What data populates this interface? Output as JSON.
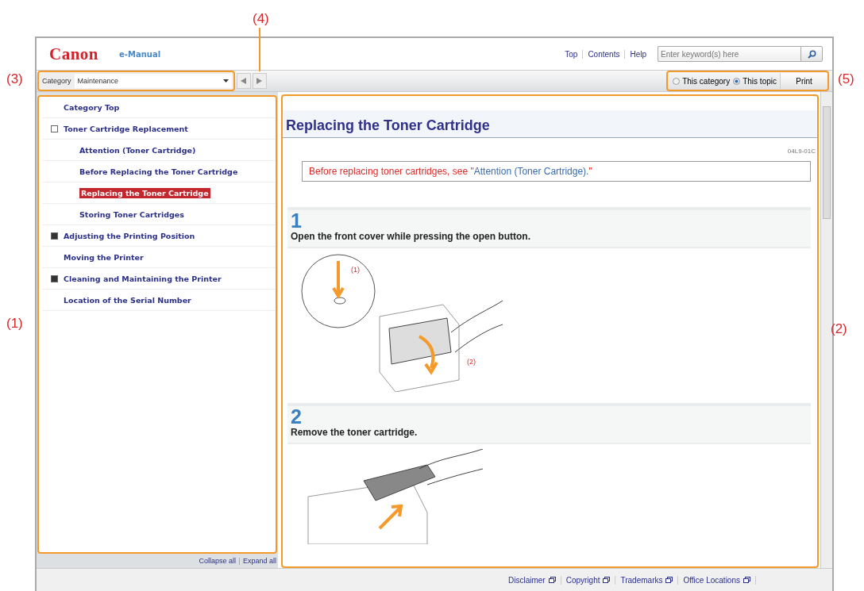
{
  "callouts": [
    {
      "label": "(4)"
    },
    {
      "label": "(3)"
    },
    {
      "label": "(1)"
    },
    {
      "label": "(5)"
    },
    {
      "label": "(2)"
    }
  ],
  "header": {
    "logo": "Canon",
    "product": "e-Manual",
    "links": [
      "Top",
      "Contents",
      "Help"
    ],
    "search": {
      "placeholder": "Enter keyword(s) here"
    }
  },
  "toolbar": {
    "category_label": "Category",
    "category_value": "Maintenance",
    "scope": [
      {
        "label": "This category",
        "selected": false
      },
      {
        "label": "This topic",
        "selected": true
      }
    ],
    "print": "Print"
  },
  "sidebar": {
    "items": [
      {
        "kind": "link",
        "label": "Category Top",
        "selected": false
      },
      {
        "kind": "group",
        "label": "Toner Cartridge Replacement",
        "expanded": true,
        "selected": false,
        "children": [
          {
            "label": "Attention (Toner Cartridge)",
            "selected": false
          },
          {
            "label": "Before Replacing the Toner Cartridge",
            "selected": false
          },
          {
            "label": "Replacing the Toner Cartridge",
            "selected": true
          },
          {
            "label": "Storing Toner Cartridges",
            "selected": false
          }
        ]
      },
      {
        "kind": "group",
        "label": "Adjusting the Printing Position",
        "expanded": false,
        "selected": false
      },
      {
        "kind": "link",
        "label": "Moving the Printer",
        "selected": false
      },
      {
        "kind": "group",
        "label": "Cleaning and Maintaining the Printer",
        "expanded": false,
        "selected": false
      },
      {
        "kind": "link",
        "label": "Location of the Serial Number",
        "selected": false
      }
    ],
    "collapse": "Collapse all",
    "expand": "Expand all"
  },
  "content": {
    "title": "Replacing the Toner Cartridge",
    "code": "04L9-01C",
    "note": {
      "before": "Before replacing toner cartridges, see \"",
      "link": "Attention (Toner Cartridge).",
      "after": "\""
    },
    "steps": [
      {
        "number": "1",
        "text": "Open the front cover while pressing the open button.",
        "marks": [
          "(1)",
          "(2)"
        ]
      },
      {
        "number": "2",
        "text": "Remove the toner cartridge."
      }
    ]
  },
  "footer": {
    "links": [
      "Disclaimer",
      "Copyright",
      "Trademarks",
      "Office Locations"
    ]
  }
}
